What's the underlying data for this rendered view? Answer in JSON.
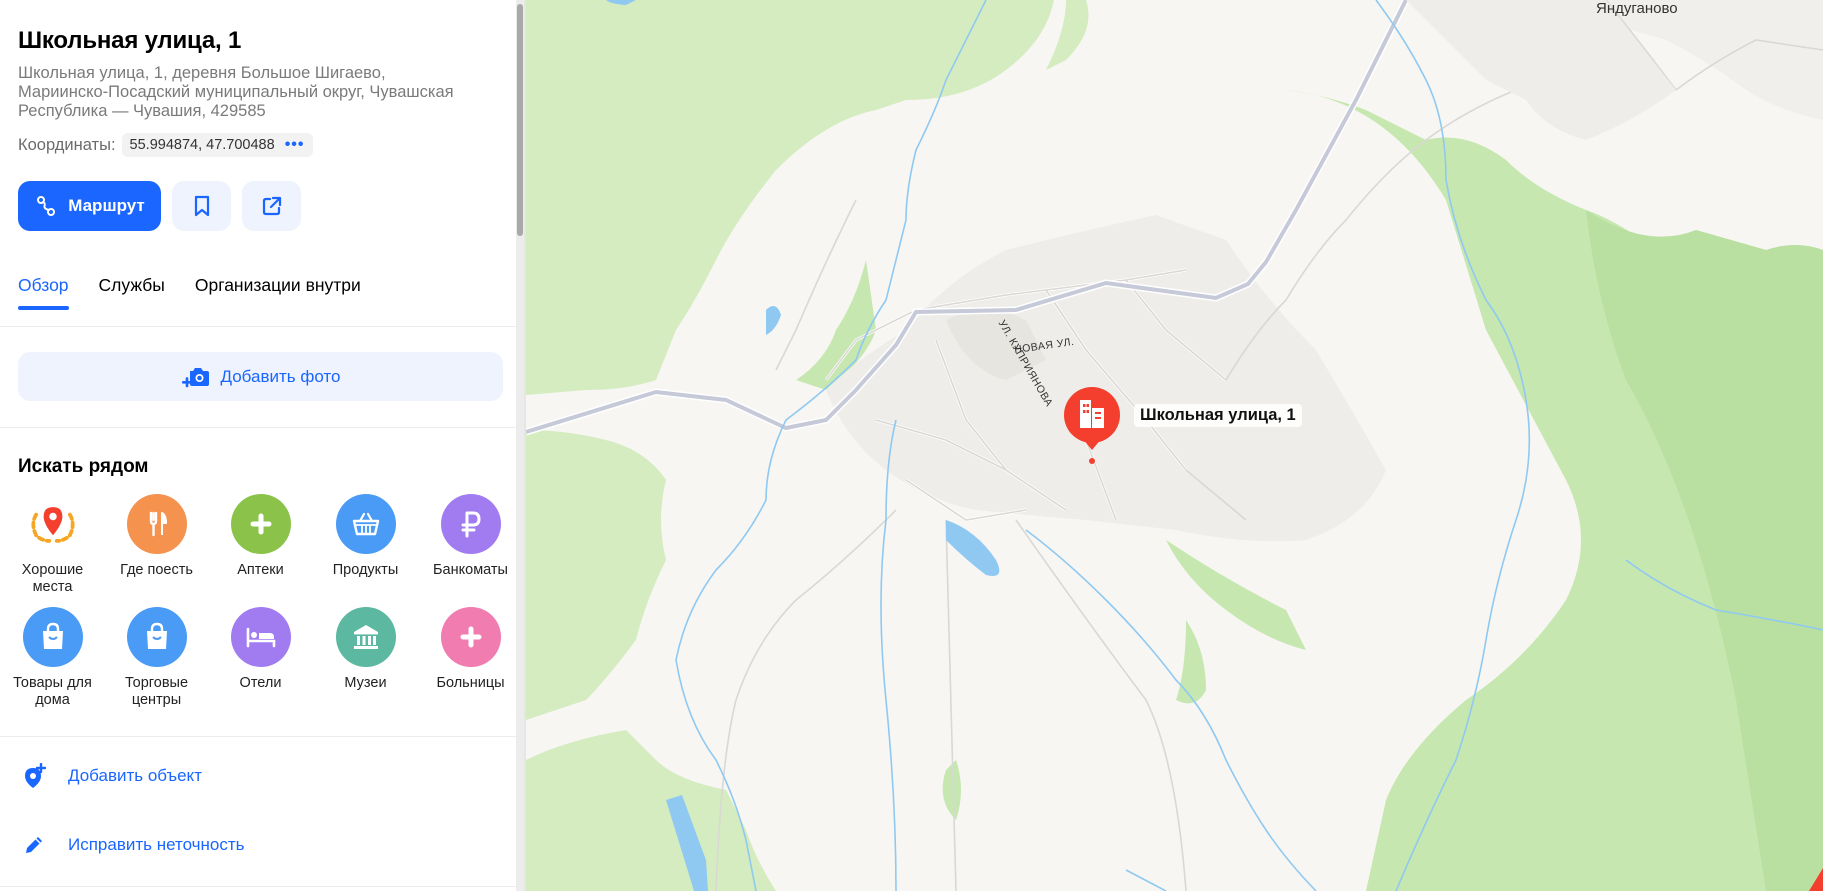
{
  "place": {
    "title": "Школьная улица, 1",
    "address_line1": "Школьная улица, 1, деревня Большое Шигаево,",
    "address_line2": "Мариинско-Посадский муниципальный округ, Чувашская",
    "address_line3": "Республика — Чувашия, 429585",
    "coords_label": "Координаты:",
    "coords_value": "55.994874, 47.700488",
    "coords_more": "•••"
  },
  "actions": {
    "route_label": "Маршрут"
  },
  "tabs": [
    {
      "label": "Обзор",
      "active": true
    },
    {
      "label": "Службы",
      "active": false
    },
    {
      "label": "Организации внутри",
      "active": false
    }
  ],
  "add_photo_label": "Добавить фото",
  "nearby": {
    "title": "Искать рядом",
    "categories": [
      {
        "label": "Хорошие места",
        "icon": "location-laurel-icon",
        "color": "#ffffff"
      },
      {
        "label": "Где поесть",
        "icon": "fork-knife-icon",
        "color": "#f5924e"
      },
      {
        "label": "Аптеки",
        "icon": "plus-icon",
        "color": "#8bc34a"
      },
      {
        "label": "Продукты",
        "icon": "basket-icon",
        "color": "#4a9bf5"
      },
      {
        "label": "Банкоматы",
        "icon": "ruble-icon",
        "color": "#a17cf0"
      },
      {
        "label": "Товары для дома",
        "icon": "shopping-bag-icon",
        "color": "#4a9bf5"
      },
      {
        "label": "Торговые центры",
        "icon": "shopping-bag-icon",
        "color": "#4a9bf5"
      },
      {
        "label": "Отели",
        "icon": "bed-icon",
        "color": "#a17cf0"
      },
      {
        "label": "Музеи",
        "icon": "museum-icon",
        "color": "#5cb8a0"
      },
      {
        "label": "Больницы",
        "icon": "plus-icon",
        "color": "#f07cb0"
      }
    ]
  },
  "bottom_actions": {
    "add_object": "Добавить объект",
    "fix_error": "Исправить неточность"
  },
  "map": {
    "pin_label": "Школьная улица, 1",
    "village_label": "Яндуганово",
    "street_new": "НОВАЯ УЛ.",
    "street_kupriyanova": "УЛ. КУПРИЯНОВА",
    "pin_color": "#f43f2f"
  }
}
